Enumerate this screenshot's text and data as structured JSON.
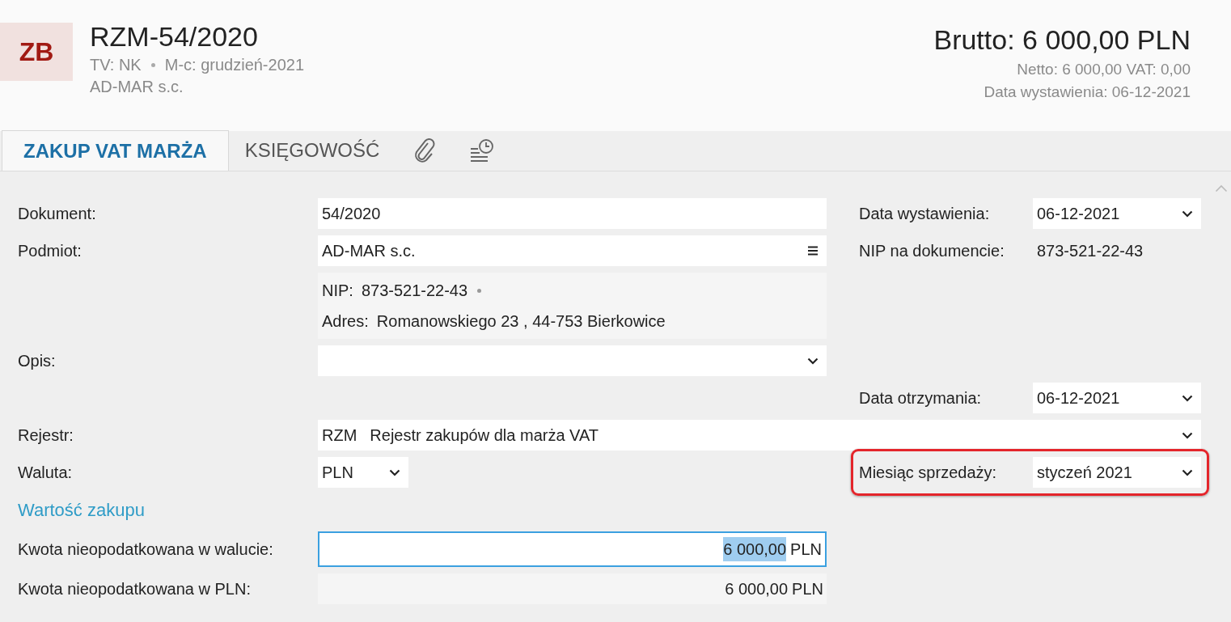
{
  "header": {
    "badge": "ZB",
    "title": "RZM-54/2020",
    "meta": [
      "TV: NK",
      "M-c: grudzień-2021"
    ],
    "company": "AD-MAR s.c.",
    "gross": "Brutto: 6 000,00 PLN",
    "net": "Netto: 6 000,00 VAT: 0,00",
    "issue_date": "Data wystawienia: 06-12-2021"
  },
  "tabs": [
    {
      "kind": "text",
      "label": "ZAKUP VAT MARŻA",
      "selected": true
    },
    {
      "kind": "text",
      "label": "KSIĘGOWOŚĆ",
      "selected": false
    },
    {
      "kind": "paperclip",
      "selected": false
    },
    {
      "kind": "history",
      "selected": false
    }
  ],
  "rows": [
    {
      "kind": "field",
      "left": {
        "label": "Dokument:",
        "field": {
          "kind": "text",
          "value": "54/2020"
        }
      },
      "right": {
        "label": "Data wystawienia:",
        "field": {
          "kind": "select",
          "value": "06-12-2021"
        }
      }
    },
    {
      "kind": "field",
      "left": {
        "label": "Podmiot:",
        "field": {
          "kind": "lookup",
          "value": "AD-MAR s.c."
        }
      },
      "right": {
        "label": "NIP na dokumencie:",
        "field": {
          "kind": "plain",
          "value": "873-521-22-43"
        }
      }
    },
    {
      "kind": "info",
      "lines": [
        {
          "label": "NIP:",
          "value": "873-521-22-43",
          "dot": true
        },
        {
          "label": "Adres:",
          "value": "Romanowskiego 23 , 44-753 Bierkowice",
          "dot": false
        }
      ]
    },
    {
      "kind": "field",
      "left": {
        "label": "Opis:",
        "field": {
          "kind": "select"
        }
      }
    },
    {
      "kind": "field",
      "right": {
        "label": "Data otrzymania:",
        "field": {
          "kind": "select",
          "value": "06-12-2021"
        }
      }
    },
    {
      "kind": "wide",
      "left": {
        "label": "Rejestr:",
        "field": {
          "kind": "select",
          "code": "RZM",
          "value": "Rejestr zakupów dla marża VAT"
        }
      }
    },
    {
      "kind": "field",
      "left": {
        "label": "Waluta:",
        "field": {
          "kind": "short-select",
          "value": "PLN"
        }
      },
      "right": {
        "label": "Miesiąc sprzedaży:",
        "highlighted": true,
        "field": {
          "kind": "select",
          "value": "styczeń 2021"
        }
      }
    },
    {
      "kind": "section",
      "label": "Wartość zakupu"
    },
    {
      "kind": "field",
      "left": {
        "label": "Kwota nieopodatkowana w walucie:",
        "field": {
          "kind": "amount",
          "value": "6 000,00",
          "suffix": "PLN",
          "focused": true,
          "text_selected": true
        }
      }
    },
    {
      "kind": "field",
      "left": {
        "label": "Kwota nieopodatkowana w PLN:",
        "field": {
          "kind": "amount-readonly",
          "value": "6 000,00",
          "suffix": "PLN",
          "focused": false,
          "text_selected": false
        }
      }
    }
  ]
}
